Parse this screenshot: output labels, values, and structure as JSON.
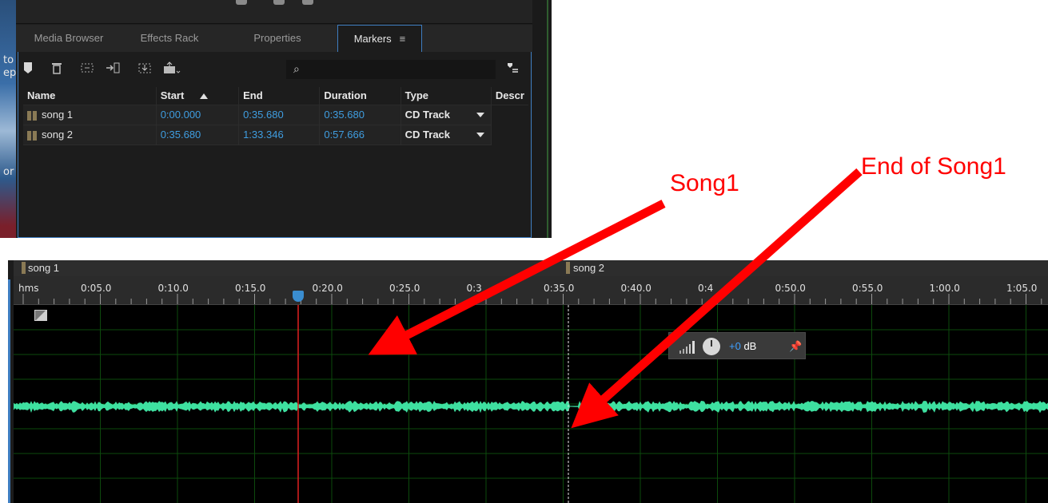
{
  "panel": {
    "tabs": [
      {
        "label": "Media Browser",
        "active": false
      },
      {
        "label": "Effects Rack",
        "active": false
      },
      {
        "label": "Properties",
        "active": false
      },
      {
        "label": "Markers",
        "active": true
      }
    ],
    "tab_menu_icon": "≡",
    "toolbar": {
      "icons": [
        "add-marker-icon",
        "delete-marker-icon",
        "merge-markers-icon",
        "insert-into-playlist-icon",
        "export-markers-icon",
        "batch-process-icon",
        "marker-filter-icon"
      ],
      "search_placeholder": "",
      "search_value": ""
    },
    "columns": [
      "Name",
      "Start",
      "End",
      "Duration",
      "Type",
      "Descr"
    ],
    "sorted_column": "Start",
    "rows": [
      {
        "name": "song 1",
        "start": "0:00.000",
        "end": "0:35.680",
        "duration": "0:35.680",
        "type": "CD Track"
      },
      {
        "name": "song 2",
        "start": "0:35.680",
        "end": "1:33.346",
        "duration": "0:57.666",
        "type": "CD Track"
      }
    ],
    "edge_fragments": [
      "to",
      "ep",
      "or"
    ]
  },
  "editor": {
    "markers": [
      {
        "label": "song 1"
      },
      {
        "label": "song 2"
      }
    ],
    "ruler": {
      "unit": "hms",
      "labels": [
        "0:05.0",
        "0:10.0",
        "0:15.0",
        "0:20.0",
        "0:25.0",
        "0:3",
        "0:35.0",
        "0:40.0",
        "0:4",
        "0:50.0",
        "0:55.0",
        "1:00.0",
        "1:05.0"
      ]
    },
    "hud": {
      "gain": "+0",
      "unit": "dB"
    },
    "waveform_color": "#3ee0a0",
    "playhead_color": "#e02020",
    "grid_color": "#0d4a0d"
  },
  "annotations": {
    "callout_1": "Song1",
    "callout_2": "End of Song1",
    "arrow_color": "#ff0000"
  }
}
